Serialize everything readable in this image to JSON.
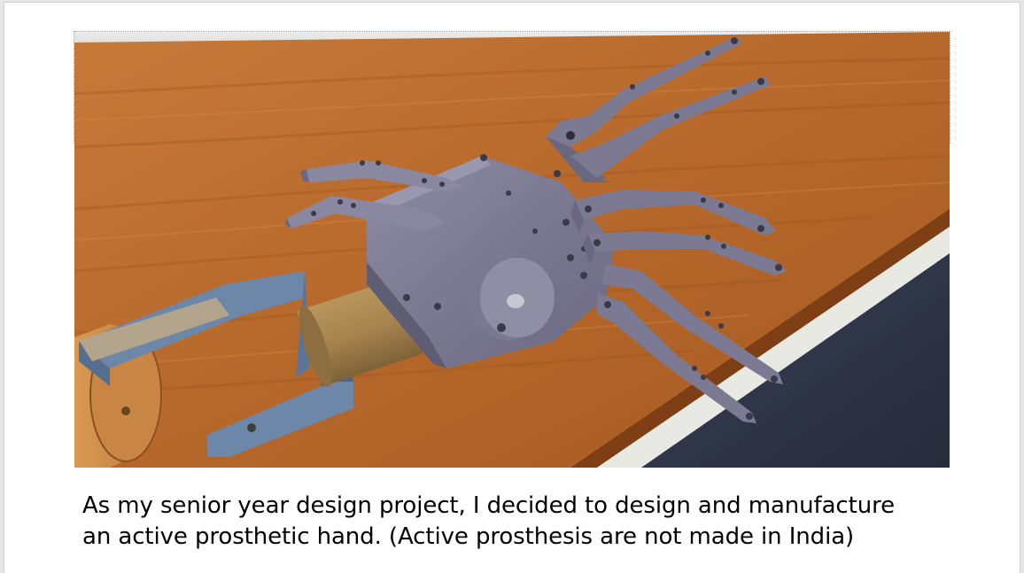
{
  "document": {
    "caption_lines": [
      "As my senior year design project, I decided to design and manufacture",
      "an active prosthetic hand. (Active prosthesis are not made in India)"
    ]
  },
  "colors": {
    "page_background": "#ffffff",
    "workspace_background": "#e6e6e6",
    "table_wood": "#b8692c",
    "wall": "#f2f2f0",
    "carpet": "#2e3548",
    "hand_metal": "#7c7a93",
    "forearm_bracket": "#6d87a8",
    "motor_gold": "#a7844f",
    "text": "#000000"
  },
  "image": {
    "icon": "prosthetic-hand-render"
  }
}
